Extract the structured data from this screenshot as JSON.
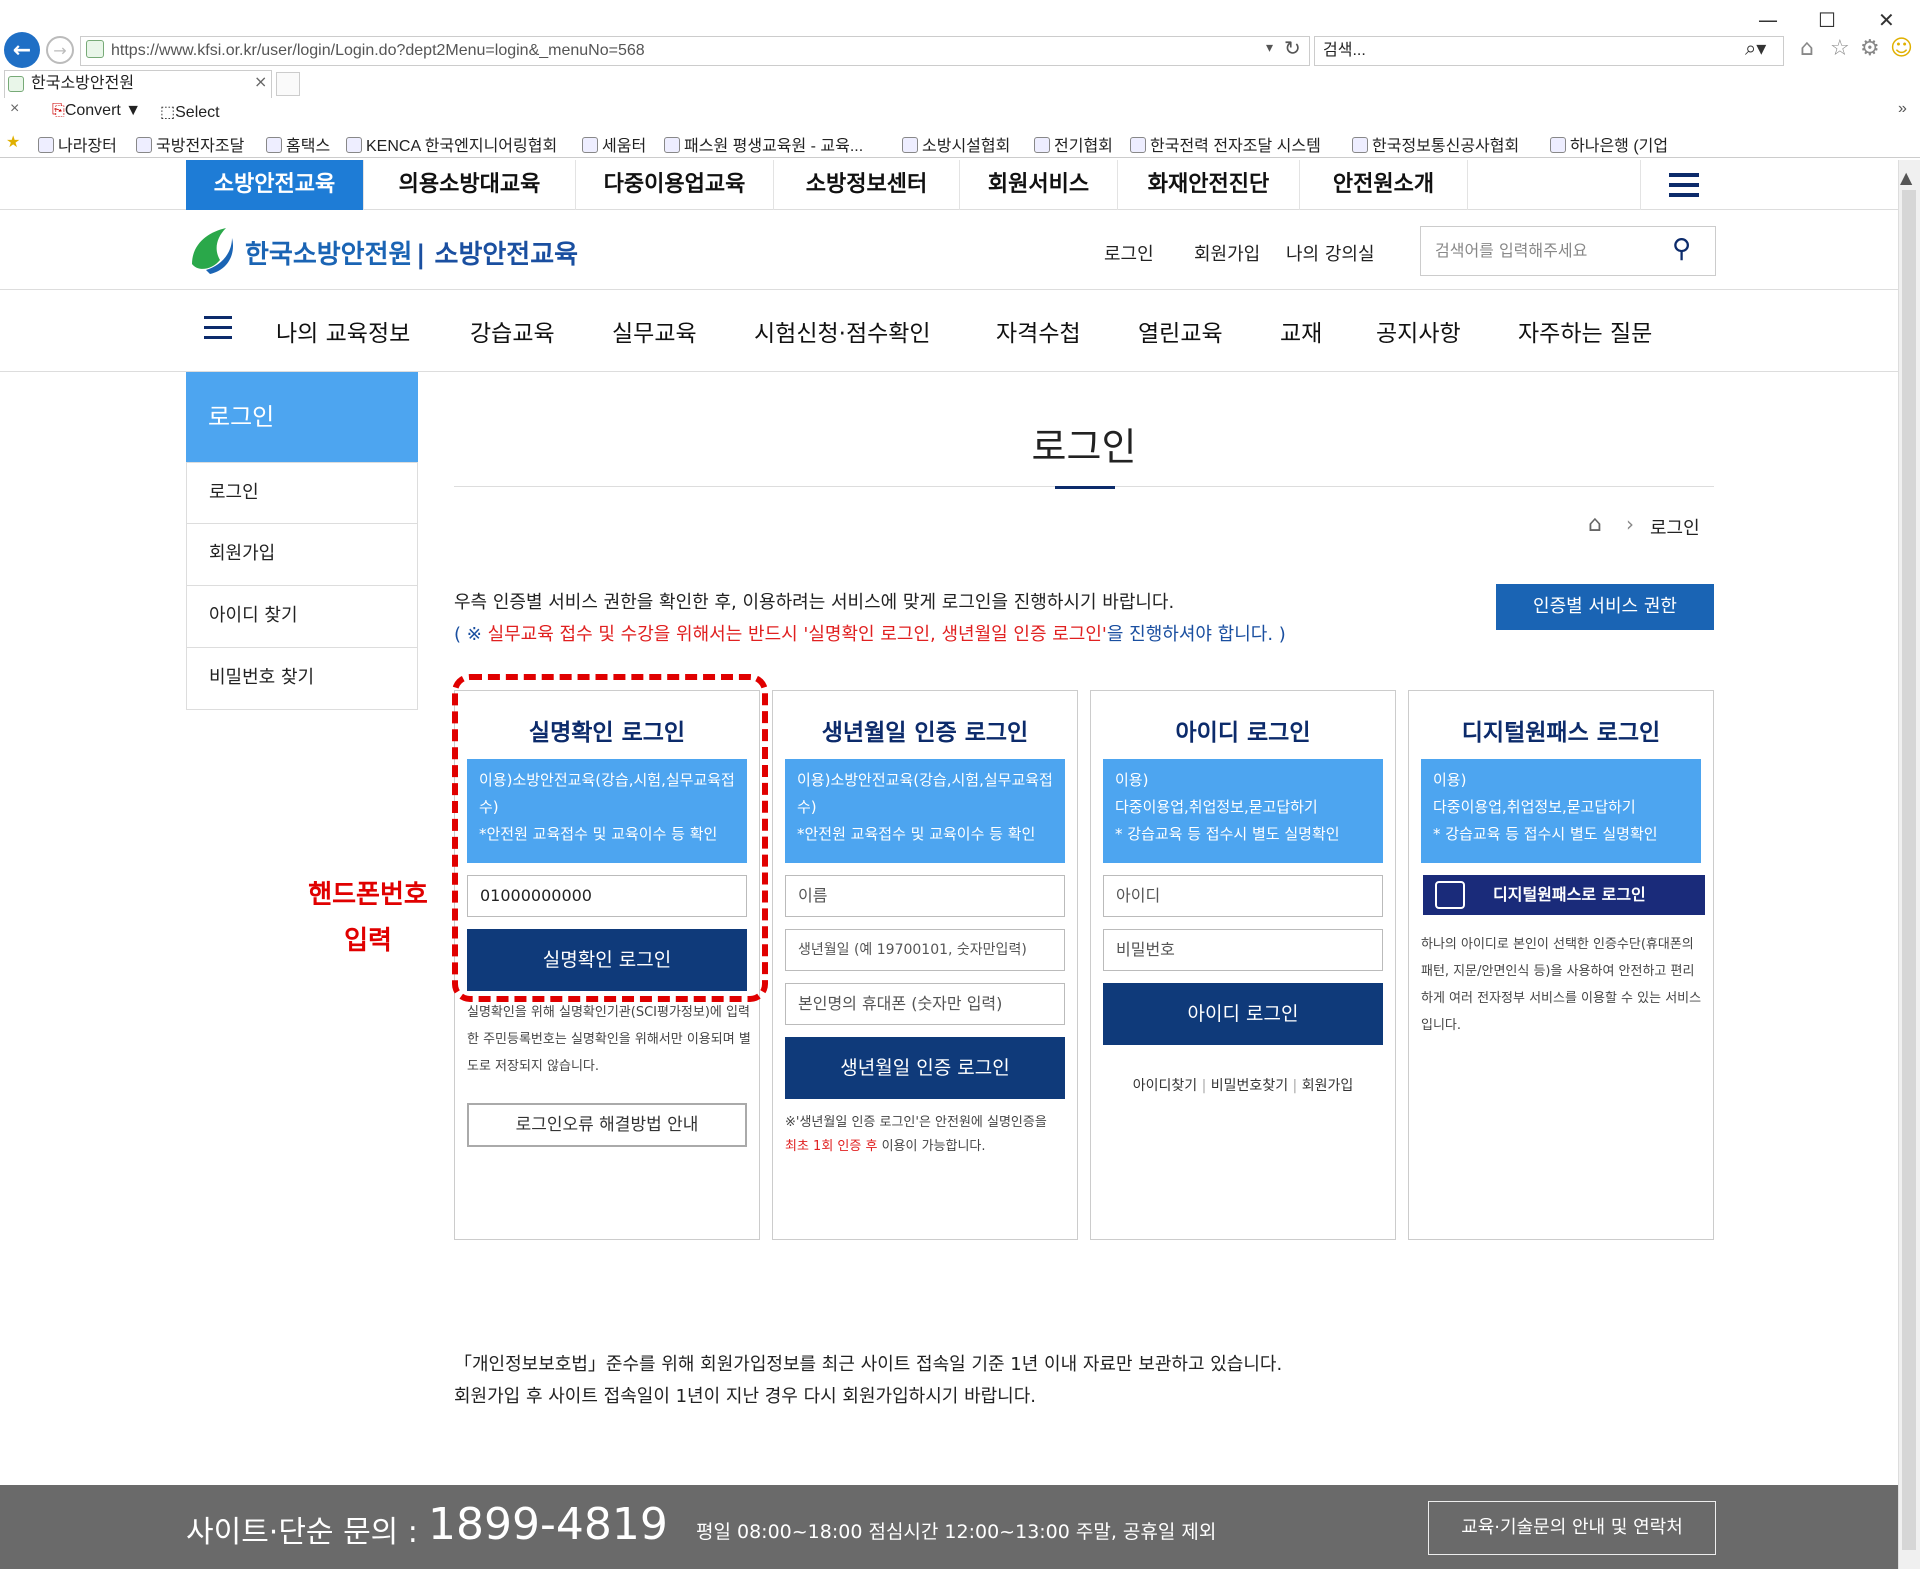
{
  "browser": {
    "url": "https://www.kfsi.or.kr/user/login/Login.do?dept2Menu=login&_menuNo=568",
    "search_placeholder": "검색...",
    "tab_title": "한국소방안전원",
    "commands": {
      "convert": "Convert",
      "select": "Select"
    },
    "favorites": [
      "나라장터",
      "국방전자조달",
      "홈택스",
      "KENCA 한국엔지니어링협회",
      "세움터",
      "패스원 평생교육원 - 교육...",
      "소방시설협회",
      "전기협회",
      "한국전력 전자조달 시스템",
      "한국정보통신공사협회",
      "하나은행 (기업"
    ]
  },
  "gnb": {
    "items": [
      "소방안전교육",
      "의용소방대교육",
      "다중이용업교육",
      "소방정보센터",
      "회원서비스",
      "화재안전진단",
      "안전원소개"
    ]
  },
  "header": {
    "logo_text": "한국소방안전원",
    "logo_sub": "| 소방안전교육",
    "util_links": [
      "로그인",
      "회원가입",
      "나의 강의실"
    ],
    "search_placeholder": "검색어를 입력해주세요"
  },
  "lnb": {
    "items": [
      "나의 교육정보",
      "강습교육",
      "실무교육",
      "시험신청·점수확인",
      "자격수첩",
      "열린교육",
      "교재",
      "공지사항",
      "자주하는 질문"
    ]
  },
  "side": {
    "title": "로그인",
    "items": [
      "로그인",
      "회원가입",
      "아이디 찾기",
      "비밀번호 찾기"
    ]
  },
  "content": {
    "title": "로그인",
    "breadcrumb": "로그인",
    "notice1": "우측 인증별 서비스 권한을 확인한 후, 이용하려는 서비스에 맞게 로그인을 진행하시기 바랍니다.",
    "notice2_a": "( ※ ",
    "notice2_b": "실무교육 접수 및 수강을 위해서는 반드시 '실명확인 로그인, 생년월일 인증 로그인'",
    "notice2_c": "을 진행하셔야 합니다. )",
    "auth_button": "인증별 서비스 권한",
    "annotation": "핸드폰번호 입력"
  },
  "cards": {
    "realname": {
      "title": "실명확인 로그인",
      "desc": "이용)소방안전교육(강습,시험,실무교육접수)\n*안전원 교육접수 및 교육이수 등 확인",
      "phone_value": "01000000000",
      "button": "실명확인 로그인",
      "note": "실명확인을 위해 실명확인기관(SCI평가정보)에 입력한 주민등록번호는 실명확인을 위해서만 이용되며 별도로 저장되지 않습니다.",
      "help_button": "로그인오류 해결방법 안내"
    },
    "birth": {
      "title": "생년월일 인증 로그인",
      "desc": "이용)소방안전교육(강습,시험,실무교육접수)\n*안전원 교육접수 및 교육이수 등 확인",
      "name_placeholder": "이름",
      "birth_placeholder": "생년월일 (예 19700101, 숫자만입력)",
      "phone_placeholder": "본인명의 휴대폰 (숫자만 입력)",
      "button": "생년월일 인증 로그인",
      "note_a": "※'생년월일 인증 로그인'은 안전원에 실명인증을",
      "note_b": "최초 1회 인증 후",
      "note_c": " 이용이 가능합니다."
    },
    "id": {
      "title": "아이디 로그인",
      "desc": "이용)\n다중이용업,취업정보,묻고답하기\n* 강습교육 등 접수시 별도 실명확인",
      "id_placeholder": "아이디",
      "pw_placeholder": "비밀번호",
      "button": "아이디 로그인",
      "links": [
        "아이디찾기",
        "비밀번호찾기",
        "회원가입"
      ]
    },
    "digital": {
      "title": "디지털원패스 로그인",
      "desc": "이용)\n다중이용업,취업정보,묻고답하기\n* 강습교육 등 접수시 별도 실명확인",
      "button": "디지털원패스로 로그인",
      "note": "하나의 아이디로 본인이 선택한 인증수단(휴대폰의 패턴, 지문/안면인식 등)을 사용하여 안전하고 편리하게 여러 전자정부 서비스를 이용할 수 있는 서비스입니다."
    }
  },
  "privacy": {
    "line1": "「개인정보보호법」준수를 위해 회원가입정보를 최근 사이트 접속일 기준 1년 이내 자료만 보관하고 있습니다.",
    "line2": "회원가입 후 사이트 접속일이 1년이 지난 경우 다시 회원가입하시기 바랍니다."
  },
  "footer": {
    "label": "사이트·단순 문의 :",
    "phone": "1899-4819",
    "hours": "평일 08:00~18:00  점심시간 12:00~13:00  주말, 공휴일 제외",
    "button": "교육·기술문의 안내 및 연락처"
  },
  "colors": {
    "primary": "#1e7cd6",
    "navy": "#0f3a7a",
    "light_blue": "#4da5f0",
    "highlight_red": "#e00000"
  }
}
